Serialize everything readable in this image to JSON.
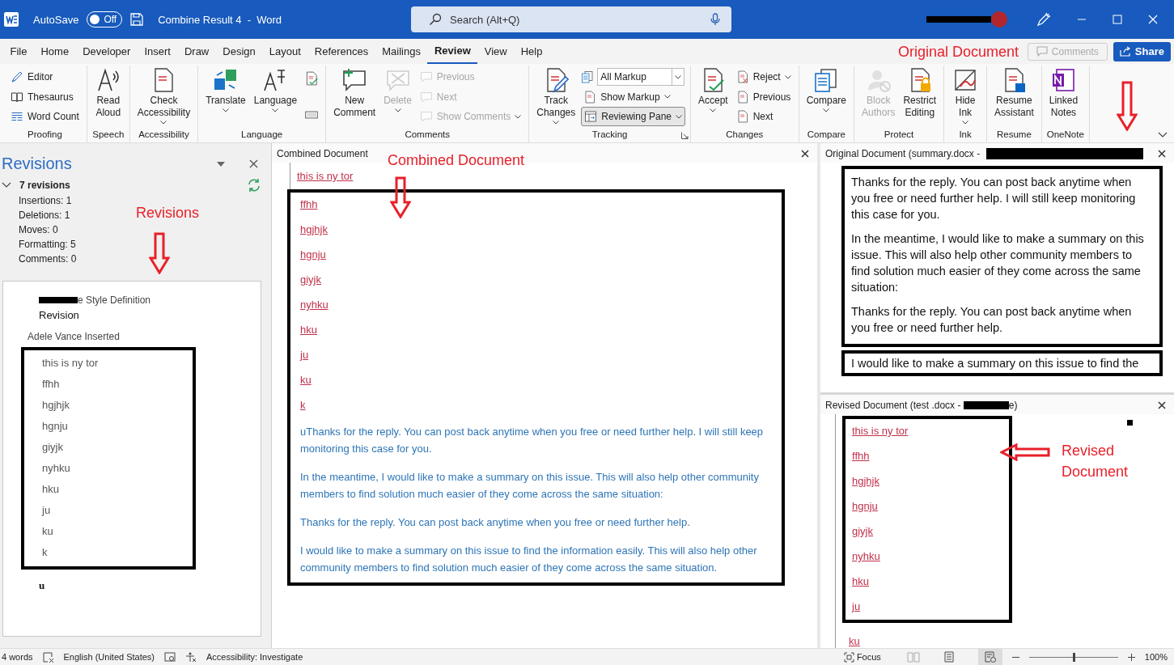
{
  "title_bar": {
    "autosave_label": "AutoSave",
    "autosave_toggle": {
      "label": "Off",
      "on": false
    },
    "document_title": "Combine Result 4  -  Word",
    "search": {
      "placeholder": "Search (Alt+Q)"
    }
  },
  "menu_tabs": [
    {
      "label": "File",
      "selected": false
    },
    {
      "label": "Home",
      "selected": false
    },
    {
      "label": "Developer",
      "selected": false
    },
    {
      "label": "Insert",
      "selected": false
    },
    {
      "label": "Draw",
      "selected": false
    },
    {
      "label": "Design",
      "selected": false
    },
    {
      "label": "Layout",
      "selected": false
    },
    {
      "label": "References",
      "selected": false
    },
    {
      "label": "Mailings",
      "selected": false
    },
    {
      "label": "Review",
      "selected": true
    },
    {
      "label": "View",
      "selected": false
    },
    {
      "label": "Help",
      "selected": false
    }
  ],
  "comments_button": {
    "label": "Comments",
    "disabled": true
  },
  "share_button": {
    "label": "Share"
  },
  "ribbon_groups": [
    {
      "label": "Proofing",
      "columns": [
        [
          {
            "kind": "small",
            "label": "Editor",
            "disabled": false,
            "dropdown": false,
            "pressed": false
          },
          {
            "kind": "small",
            "label": "Thesaurus",
            "disabled": false,
            "dropdown": false,
            "pressed": false
          },
          {
            "kind": "small",
            "label": "Word Count",
            "disabled": false,
            "dropdown": false,
            "pressed": false
          }
        ]
      ]
    },
    {
      "label": "Speech",
      "columns": [
        [
          {
            "kind": "large",
            "label": "Read\nAloud",
            "disabled": false,
            "dropdown": false,
            "pressed": false
          }
        ]
      ]
    },
    {
      "label": "Accessibility",
      "columns": [
        [
          {
            "kind": "large",
            "label": "Check\nAccessibility",
            "disabled": false,
            "dropdown": true,
            "pressed": false
          }
        ]
      ]
    },
    {
      "label": "Language",
      "columns": [
        [
          {
            "kind": "large",
            "label": "Translate",
            "disabled": false,
            "dropdown": true,
            "pressed": false
          }
        ],
        [
          {
            "kind": "large",
            "label": "Language",
            "disabled": false,
            "dropdown": true,
            "pressed": false
          }
        ],
        [
          {
            "kind": "icon",
            "disabled": false,
            "dropdown": false,
            "pressed": false
          },
          {
            "kind": "icon",
            "disabled": false,
            "dropdown": false,
            "pressed": false
          }
        ]
      ]
    },
    {
      "label": "Comments",
      "columns": [
        [
          {
            "kind": "large",
            "label": "New\nComment",
            "disabled": false,
            "dropdown": false,
            "pressed": false
          }
        ],
        [
          {
            "kind": "large",
            "label": "Delete",
            "disabled": true,
            "dropdown": true,
            "pressed": false
          }
        ],
        [
          {
            "kind": "small",
            "label": "Previous",
            "disabled": true,
            "dropdown": false,
            "pressed": false
          },
          {
            "kind": "small",
            "label": "Next",
            "disabled": true,
            "dropdown": false,
            "pressed": false
          },
          {
            "kind": "small",
            "label": "Show Comments",
            "disabled": true,
            "dropdown": true,
            "pressed": false
          }
        ]
      ]
    },
    {
      "label": "Tracking",
      "launcher": true,
      "columns": [
        [
          {
            "kind": "large",
            "label": "Track\nChanges",
            "disabled": false,
            "dropdown": true,
            "pressed": false
          }
        ],
        [
          {
            "kind": "select",
            "value": "All Markup",
            "disabled": false,
            "dropdown": true,
            "pressed": false
          },
          {
            "kind": "small",
            "label": "Show Markup",
            "disabled": false,
            "dropdown": true,
            "pressed": false
          },
          {
            "kind": "small",
            "label": "Reviewing Pane",
            "disabled": false,
            "dropdown": true,
            "pressed": true
          }
        ]
      ]
    },
    {
      "label": "Changes",
      "columns": [
        [
          {
            "kind": "large",
            "label": "Accept",
            "disabled": false,
            "dropdown": true,
            "pressed": false
          }
        ],
        [
          {
            "kind": "small",
            "label": "Reject",
            "disabled": false,
            "dropdown": true,
            "pressed": false
          },
          {
            "kind": "small",
            "label": "Previous",
            "disabled": false,
            "dropdown": false,
            "pressed": false
          },
          {
            "kind": "small",
            "label": "Next",
            "disabled": false,
            "dropdown": false,
            "pressed": false
          }
        ]
      ]
    },
    {
      "label": "Compare",
      "columns": [
        [
          {
            "kind": "large",
            "label": "Compare",
            "disabled": false,
            "dropdown": true,
            "pressed": false
          }
        ]
      ]
    },
    {
      "label": "Protect",
      "columns": [
        [
          {
            "kind": "large",
            "label": "Block\nAuthors",
            "disabled": true,
            "dropdown": false,
            "pressed": false
          }
        ],
        [
          {
            "kind": "large",
            "label": "Restrict\nEditing",
            "disabled": false,
            "dropdown": false,
            "pressed": false
          }
        ]
      ]
    },
    {
      "label": "Ink",
      "columns": [
        [
          {
            "kind": "large",
            "label": "Hide\nInk",
            "disabled": false,
            "dropdown": true,
            "pressed": false
          }
        ]
      ]
    },
    {
      "label": "Resume",
      "columns": [
        [
          {
            "kind": "large",
            "label": "Resume\nAssistant",
            "disabled": false,
            "dropdown": false,
            "pressed": false
          }
        ]
      ]
    },
    {
      "label": "OneNote",
      "columns": [
        [
          {
            "kind": "large",
            "label": "Linked\nNotes",
            "disabled": false,
            "dropdown": false,
            "pressed": false
          }
        ]
      ]
    }
  ],
  "revisions_pane": {
    "title": "Revisions",
    "summary": {
      "label": "7 revisions",
      "expanded": true,
      "lines": [
        "Insertions: 1",
        "Deletions: 1",
        "Moves: 0",
        "Formatting: 5",
        "Comments: 0"
      ]
    },
    "entries": [
      {
        "heading": "e Style Definition",
        "redacted_prefix": true,
        "lines": [
          "Revision"
        ]
      },
      {
        "heading": "Adele Vance Inserted",
        "redacted_prefix": false,
        "lines": [
          "this is ny tor",
          "ffhh",
          "hgjhjk",
          "hgnju",
          "giyjk",
          "nyhku",
          "hku",
          "ju",
          "ku",
          "k",
          "u"
        ]
      }
    ]
  },
  "combined_document": {
    "title": "Combined Document",
    "inserted_lines": [
      "this is ny tor",
      "ffhh",
      "hgjhjk",
      "hgnju",
      "giyjk",
      "nyhku",
      "hku",
      "ju",
      "ku",
      "k"
    ],
    "paragraphs": [
      "uThanks for the reply. You can post back anytime when you free or need further help. I will still keep monitoring this case for you.",
      "In the meantime, I would like to make a summary on this issue. This will also help other community members to find solution much easier of they come across the same situation:",
      "Thanks for the reply. You can post back anytime when you free or need further help.",
      "I would like to make a summary on this issue to find the information easily. This will also help other community members to find solution much easier of they come across the same situation."
    ]
  },
  "original_document": {
    "title": "Original Document (summary.docx - ",
    "paragraphs": [
      "Thanks for the reply. You can post back anytime when you free or need further help. I will still keep monitoring this case for you.",
      "In the meantime, I would like to make a summary on this issue. This will also help other community members to find solution much easier of they come across the same situation:",
      "Thanks for the reply. You can post back anytime when you free or need further help.",
      "I would like to make a summary on this issue to find the"
    ]
  },
  "revised_document": {
    "title_start": "Revised Document (test .docx - ",
    "title_end": "e)",
    "lines": [
      "this is ny tor",
      "ffhh",
      "hgjhjk",
      "hgnju",
      "giyjk",
      "nyhku",
      "hku",
      "ju",
      "ku"
    ]
  },
  "status_bar": {
    "word_count": "4 words",
    "language": "English (United States)",
    "accessibility": "Accessibility: Investigate",
    "focus": "Focus",
    "zoom": {
      "level": 0.5,
      "reading": "100%"
    }
  },
  "annotations": [
    {
      "label": "Revisions"
    },
    {
      "label": "Combined Document"
    },
    {
      "label": "Original Document"
    },
    {
      "label": "Revised Document"
    }
  ]
}
